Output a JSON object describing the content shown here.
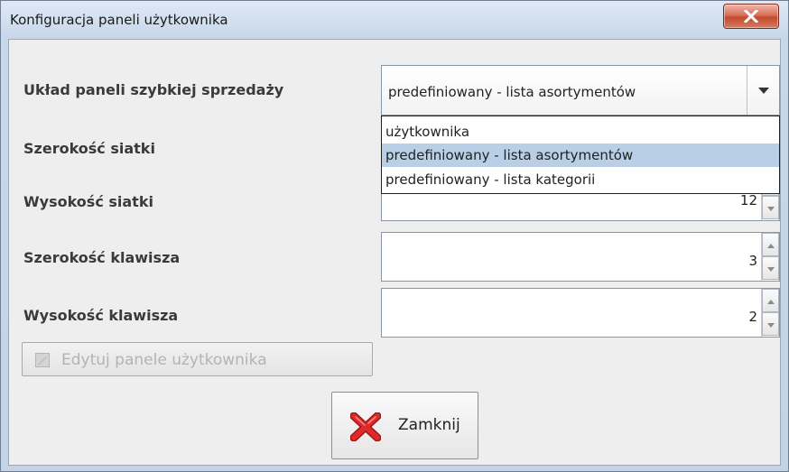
{
  "window": {
    "title": "Konfiguracja paneli użytkownika"
  },
  "form": {
    "layout_label": "Układ paneli szybkiej sprzedaży",
    "layout_value": "predefiniowany - lista asortymentów",
    "layout_options": [
      "użytkownika",
      "predefiniowany - lista asortymentów",
      "predefiniowany - lista kategorii"
    ],
    "grid_width_label": "Szerokość siatki",
    "grid_height_label": "Wysokość siatki",
    "grid_height_value": "12",
    "key_width_label": "Szerokość klawisza",
    "key_width_value": "3",
    "key_height_label": "Wysokość klawisza",
    "key_height_value": "2"
  },
  "buttons": {
    "edit_panels": "Edytuj panele użytkownika",
    "close": "Zamknij"
  },
  "icons": {
    "close_window": "close-icon",
    "dropdown": "chevron-down-icon",
    "edit": "edit-icon",
    "close_action": "red-x-icon"
  }
}
